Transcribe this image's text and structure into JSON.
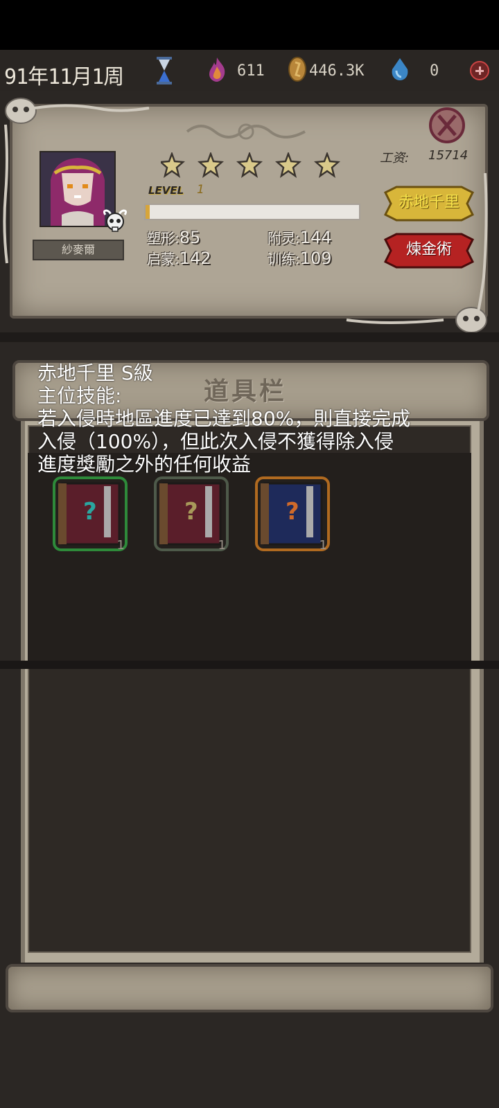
{
  "topbar": {
    "date": "91年11月1周",
    "flame_value": "611",
    "coin_value": "446.3K",
    "gem_value": "0"
  },
  "character": {
    "name": "紗麥爾",
    "stars": 5,
    "level_label": "LEVEL",
    "level_value": "1",
    "xp_progress": 0.02,
    "salary_label": "工资:",
    "salary_value": "15714",
    "stats": {
      "shape_label": "塑形:",
      "shape_value": "85",
      "spirit_label": "附灵:",
      "spirit_value": "144",
      "enlight_label": "启蒙:",
      "enlight_value": "142",
      "train_label": "训练:",
      "train_value": "109"
    },
    "skill_button": "赤地千里",
    "alchemy_button": "煉金術"
  },
  "inventory": {
    "title": "道具栏",
    "items": [
      {
        "icon": "green-mystery-book-icon",
        "count": "1"
      },
      {
        "icon": "gray-mystery-book-icon",
        "count": "1"
      },
      {
        "icon": "orange-mystery-book-icon",
        "count": "1"
      }
    ]
  },
  "tooltip": {
    "line1": "赤地千里 S級",
    "line2": "主位技能:",
    "line3": "若入侵時地區進度已達到80%，則直接完成",
    "line4": "入侵（100%），但此次入侵不獲得除入侵",
    "line5": "進度獎勵之外的任何收益"
  },
  "colors": {
    "parchment": "#aea595",
    "gold_button": "#d8b63a",
    "red_button": "#b52222",
    "tooltip_text": "#ffffff"
  }
}
